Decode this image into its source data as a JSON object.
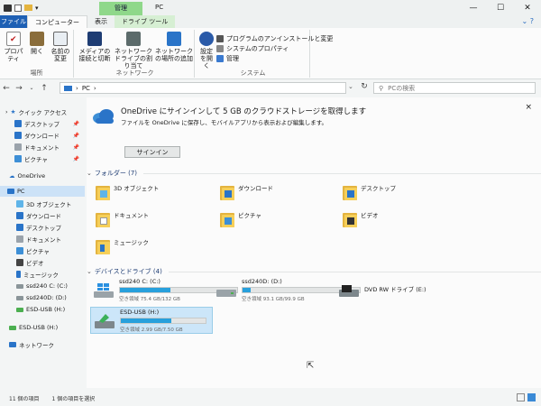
{
  "window": {
    "title": "PC",
    "context_group": "管理",
    "controls": [
      "—",
      "☐",
      "✕"
    ]
  },
  "tabs": {
    "file": "ファイル",
    "computer": "コンピューター",
    "view": "表示",
    "drive_tools": "ドライブ ツール"
  },
  "ribbon": {
    "location": {
      "label": "場所",
      "properties": "プロパティ",
      "open": "開く",
      "rename": "名前の変更"
    },
    "network": {
      "label": "ネットワーク",
      "access_media": "メディアの接続と切断",
      "map_drive": "ネットワーク ドライブの割り当て",
      "add_location": "ネットワークの場所の追加"
    },
    "system": {
      "label": "システム",
      "open_settings": "設定を開く",
      "uninstall": "プログラムのアンインストールと変更",
      "sys_props": "システムのプロパティ",
      "manage": "管理"
    }
  },
  "address": {
    "path": "PC",
    "search_placeholder": "PCの検索"
  },
  "nav": {
    "quick_access": "クイック アクセス",
    "qa_items": [
      "デスクトップ",
      "ダウンロード",
      "ドキュメント",
      "ピクチャ"
    ],
    "onedrive": "OneDrive",
    "pc": "PC",
    "pc_items": [
      "3D オブジェクト",
      "ダウンロード",
      "デスクトップ",
      "ドキュメント",
      "ピクチャ",
      "ビデオ",
      "ミュージック",
      "ssd240 C: (C:)",
      "ssd240D: (D:)",
      "ESD-USB (H:)"
    ],
    "esd_usb": "ESD-USB (H:)",
    "network": "ネットワーク"
  },
  "banner": {
    "title": "OneDrive にサインインして 5 GB のクラウドストレージを取得します",
    "subtitle": "ファイルを OneDrive に保存し、モバイルアプリから表示および編集します。",
    "signin": "サインイン",
    "close": "×"
  },
  "folders_section": "フォルダー (7)",
  "folders": [
    "3D オブジェクト",
    "ダウンロード",
    "デスクトップ",
    "ドキュメント",
    "ピクチャ",
    "ビデオ",
    "ミュージック"
  ],
  "drives_section": "デバイスとドライブ (4)",
  "drives": [
    {
      "name": "ssd240 C: (C:)",
      "free": "空き領域 75.4 GB/132 GB",
      "used": 0.43
    },
    {
      "name": "ssd240D: (D:)",
      "free": "空き領域 93.1 GB/99.9 GB",
      "used": 0.07
    },
    {
      "name": "DVD RW ドライブ (E:)",
      "free": "",
      "used": null
    },
    {
      "name": "ESD-USB (H:)",
      "free": "空き領域 2.99 GB/7.50 GB",
      "used": 0.6
    }
  ],
  "status": {
    "count": "11 個の項目",
    "selected": "1 個の項目を選択"
  },
  "colors": {
    "accent": "#1e60b4",
    "folder": "#f6cf59",
    "drive_bar": "#28a0dc",
    "context": "#8fd88a"
  }
}
